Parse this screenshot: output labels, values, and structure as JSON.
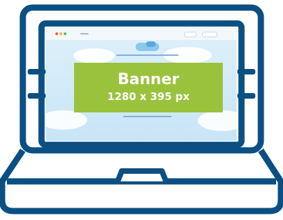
{
  "banner": {
    "title": "Banner",
    "size": "1280 x 395 px",
    "fill_color": "#9bc23c"
  },
  "colors": {
    "outline": "#0b4f83",
    "screen_background": "#d6ecfa"
  },
  "icons": [
    "laptop-icon"
  ]
}
